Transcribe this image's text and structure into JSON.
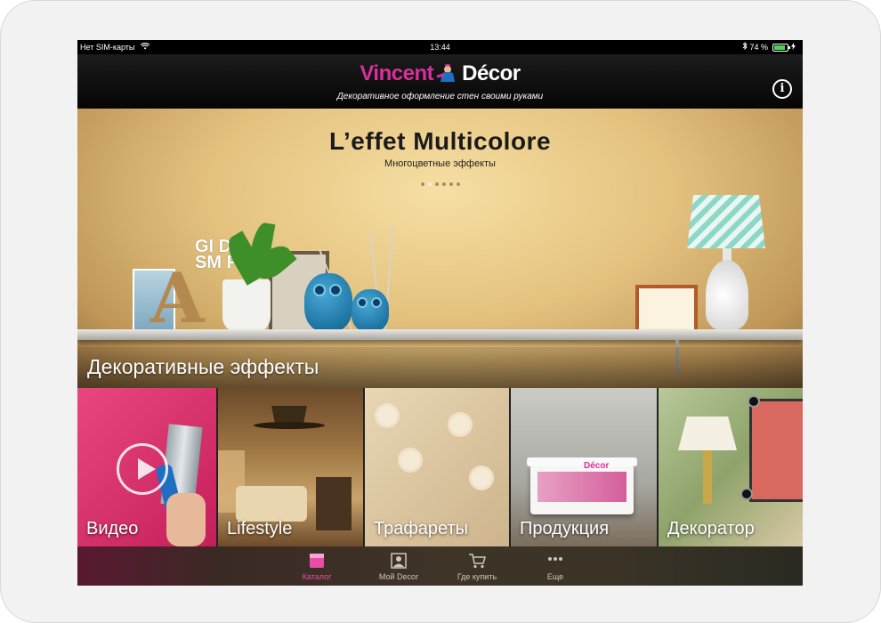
{
  "status_bar": {
    "carrier": "Нет SIM-карты",
    "time": "13:44",
    "battery": "74 %",
    "battery_level": 0.74
  },
  "header": {
    "logo_left": "Vincent",
    "logo_right": "Décor",
    "tagline": "Декоративное оформление стен своими руками",
    "info_symbol": "i"
  },
  "hero": {
    "title": "L’effet Multicolore",
    "subtitle": "Многоцветные эффекты",
    "page_count": 6,
    "active_page": 1,
    "decor_letters": "GI DR SM PL",
    "decor_letter_a": "A"
  },
  "section": {
    "title": "Декоративные эффекты"
  },
  "tiles": [
    {
      "label": "Видео"
    },
    {
      "label": "Lifestyle"
    },
    {
      "label": "Трафареты"
    },
    {
      "label": "Продукция"
    },
    {
      "label": "Декоратор"
    }
  ],
  "tabbar": {
    "items": [
      {
        "label": "Каталог",
        "icon": "catalog-icon",
        "active": true
      },
      {
        "label": "Мой Decor",
        "icon": "my-decor-icon",
        "active": false
      },
      {
        "label": "Где купить",
        "icon": "shopping-cart-icon",
        "active": false
      },
      {
        "label": "Еще",
        "icon": "more-dots-icon",
        "active": false
      }
    ]
  },
  "colors": {
    "brand_pink": "#d82f9a",
    "active_tab": "#e94ea6"
  }
}
